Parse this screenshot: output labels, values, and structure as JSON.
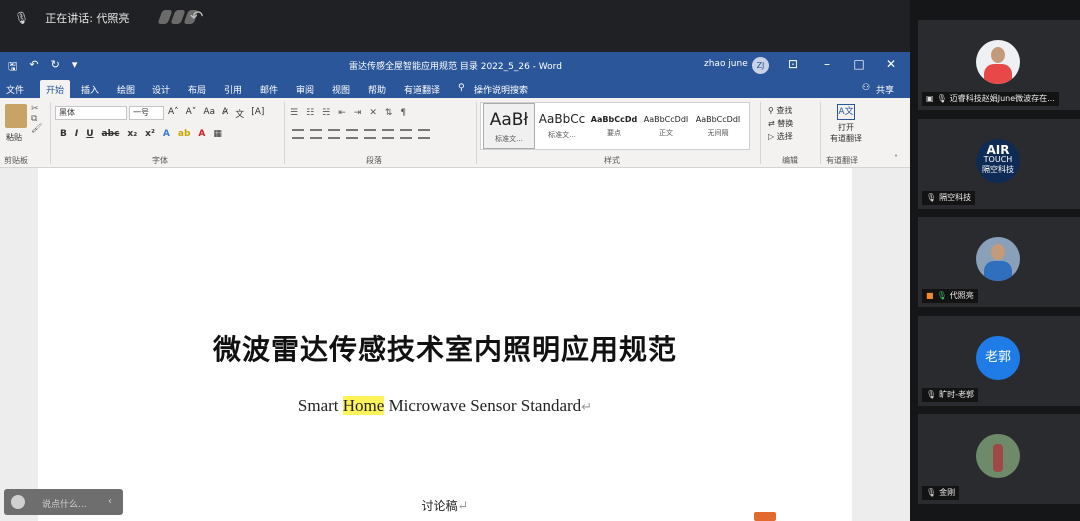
{
  "meeting": {
    "speaking_label": "正在讲话: 代照亮"
  },
  "word": {
    "doc_title": "雷达传感全屋智能应用规范 目录 2022_5_26 - Word",
    "user": "zhao june",
    "user_initials": "ZJ",
    "tabs": [
      "文件",
      "开始",
      "插入",
      "绘图",
      "设计",
      "布局",
      "引用",
      "邮件",
      "审阅",
      "视图",
      "帮助",
      "有道翻译",
      "操作说明搜索"
    ],
    "share": "共享",
    "ribbon": {
      "paste": "粘贴",
      "font_name": "黑体",
      "font_size": "一号",
      "groups": [
        "剪贴板",
        "字体",
        "段落",
        "样式",
        "编辑",
        "有道翻译"
      ],
      "styles": [
        {
          "preview": "AaBł",
          "name": "标准文..."
        },
        {
          "preview": "AaBbCc",
          "name": "标准文..."
        },
        {
          "preview": "AaBbCcDd",
          "name": "要点"
        },
        {
          "preview": "AaBbCcDdI",
          "name": "正文"
        },
        {
          "preview": "AaBbCcDdI",
          "name": "无间隔"
        }
      ],
      "editing": [
        "查找",
        "替换",
        "选择"
      ],
      "translate_lines": [
        "打开",
        "有道翻译"
      ]
    }
  },
  "document": {
    "title": "微波雷达传感技术室内照明应用规范",
    "subtitle_pre": "Smart ",
    "subtitle_hl": "Home",
    "subtitle_post": " Microwave Sensor Standard",
    "draft": "讨论稿",
    "para_mark": "↵"
  },
  "chat": {
    "placeholder": "说点什么..."
  },
  "participants": [
    {
      "name": "迈睿科技赵娟June微波存在...",
      "avatar": "person"
    },
    {
      "name": "隔空科技",
      "avatar": "logo",
      "logo_top": "AIR",
      "logo_mid": "TOUCH",
      "logo_bot": "隔空科技"
    },
    {
      "name": "代照亮",
      "avatar": "person2"
    },
    {
      "name": "旷时-老郭",
      "avatar": "text",
      "avatar_text": "老郭"
    },
    {
      "name": "金刚",
      "avatar": "photo"
    }
  ],
  "colors": {
    "word_blue": "#2b579a",
    "highlight": "#fff35a",
    "avatar_blue": "#1f7be6"
  }
}
